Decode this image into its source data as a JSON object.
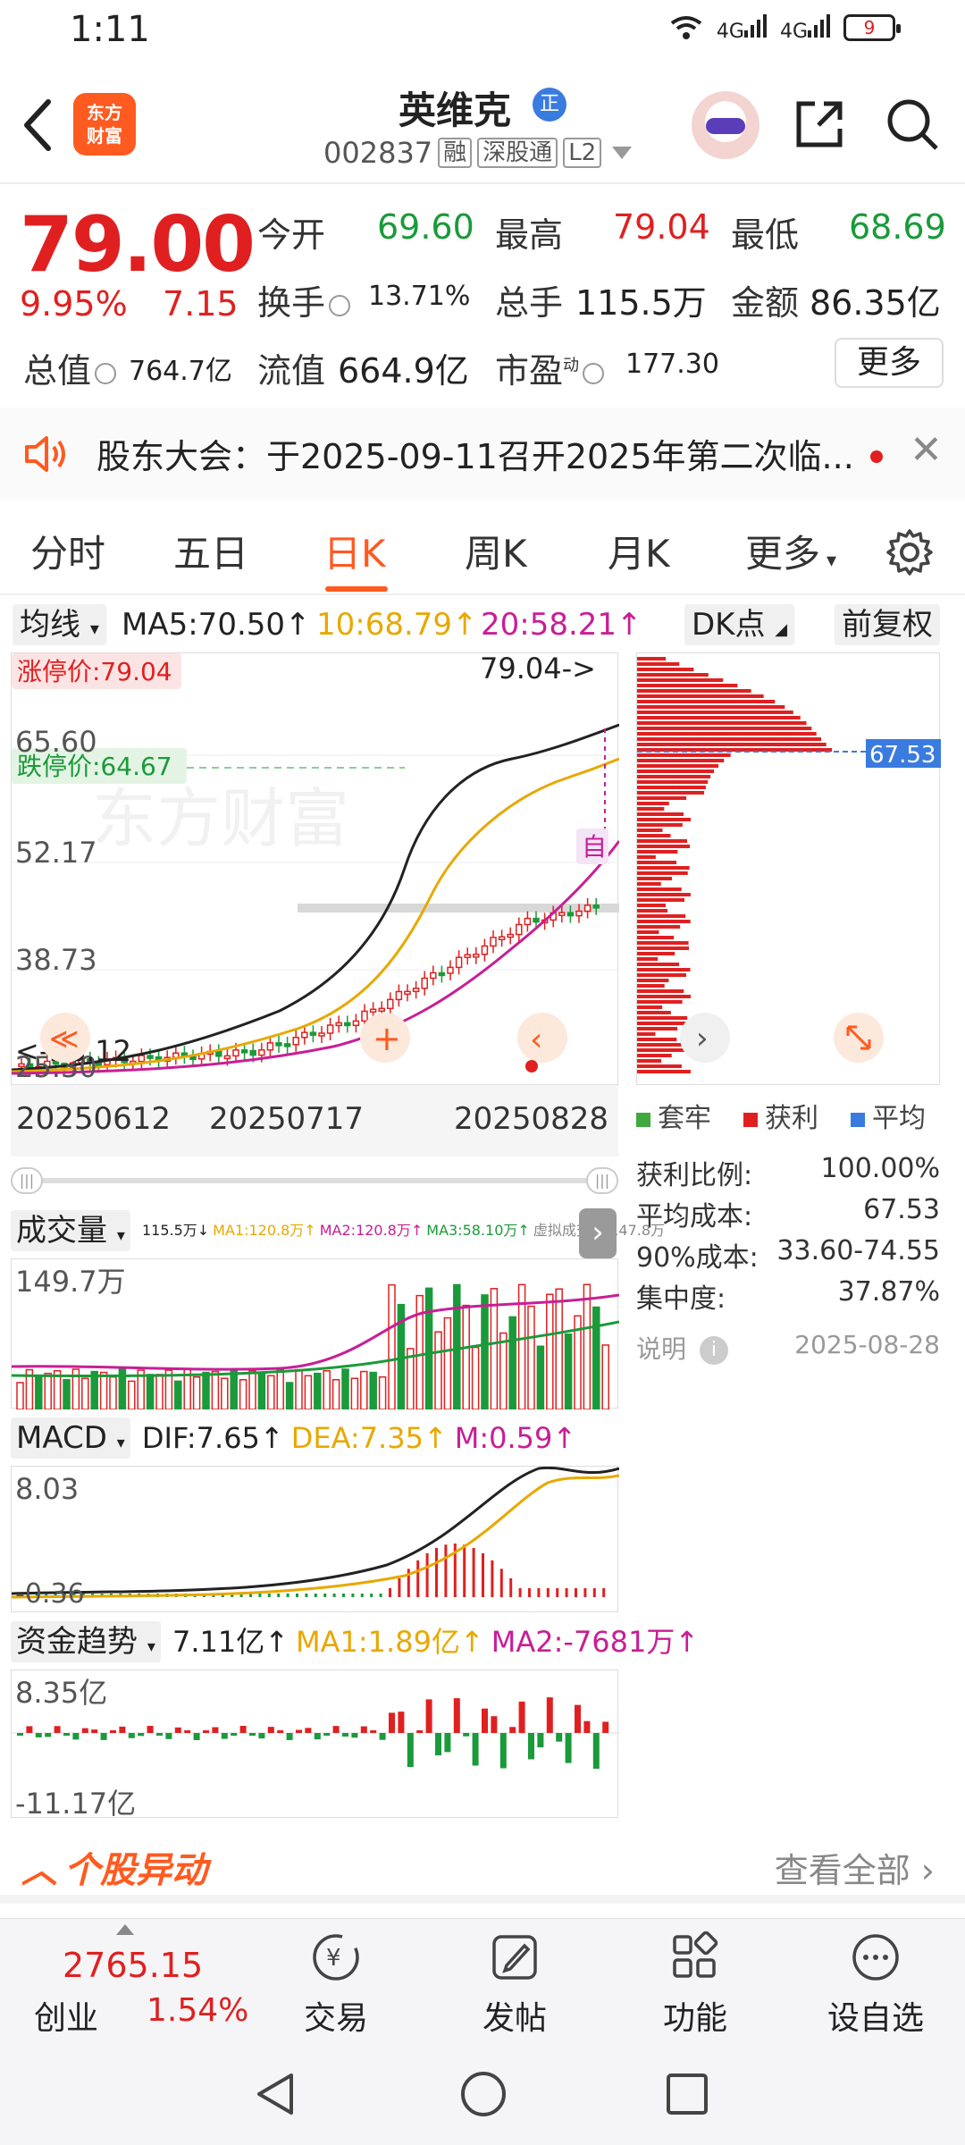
{
  "status_bar": {
    "time": "1:11",
    "network": "4G",
    "network2": "4G",
    "battery": "9"
  },
  "header": {
    "logo_text_1": "东方",
    "logo_text_2": "财富",
    "stock_name": "英维克",
    "name_badge": "正",
    "stock_code": "002837",
    "tags": [
      "融",
      "深股通",
      "L2"
    ]
  },
  "quote": {
    "price": "79.00",
    "change_pct": "9.95%",
    "change_amt": "7.15",
    "open_label": "今开",
    "open": "69.60",
    "high_label": "最高",
    "high": "79.04",
    "low_label": "最低",
    "low": "68.69",
    "turnover_label": "换手",
    "turnover": "13.71%",
    "volume_label": "总手",
    "volume": "115.5万",
    "amount_label": "金额",
    "amount": "86.35亿",
    "mktcap_label": "总值",
    "mktcap": "764.7亿",
    "float_label": "流值",
    "float_cap": "664.9亿",
    "pe_label": "市盈",
    "pe_sup": "动",
    "pe": "177.30",
    "more_button": "更多"
  },
  "notice": {
    "text": "股东大会：于2025-09-11召开2025年第二次临..."
  },
  "tabs": [
    "分时",
    "五日",
    "日K",
    "周K",
    "月K",
    "更多"
  ],
  "active_tab": "日K",
  "chart_controls": {
    "ma_select": "均线",
    "ma5": "MA5:70.50↑",
    "ma10": "10:68.79↑",
    "ma20": "20:58.21↑",
    "dk_select": "DK点",
    "adjust": "前复权"
  },
  "kline": {
    "limit_up_label": "涨停价:79.04",
    "limit_down_label": "跌停价:64.67",
    "y_ticks": [
      "65.60",
      "52.17",
      "38.73",
      "25.30"
    ],
    "high_marker": "79.04->",
    "low_marker": "<-26.12",
    "auto_label": "自",
    "watermark": "东方财富",
    "dates": [
      "20250612",
      "20250717",
      "20250828"
    ]
  },
  "profile": {
    "avg_cost_marker": "67.53",
    "legend": [
      "套牢",
      "获利",
      "平均"
    ],
    "stats": [
      {
        "label": "获利比例:",
        "value": "100.00%"
      },
      {
        "label": "平均成本:",
        "value": "67.53"
      },
      {
        "label": "90%成本:",
        "value": "33.60-74.55"
      },
      {
        "label": "集中度:",
        "value": "37.87%"
      }
    ],
    "note_label": "说明",
    "note_date": "2025-08-28"
  },
  "volume": {
    "select": "成交量",
    "values_line": "115.5万↓",
    "ma1": "MA1:120.8万↑",
    "ma2": "MA2:120.8万↑",
    "ma3": "MA3:58.10万↑",
    "virtual": "虚拟成交量:147.8万",
    "max_label": "149.7万"
  },
  "macd": {
    "select": "MACD",
    "dif": "DIF:7.65↑",
    "dea": "DEA:7.35↑",
    "m": "M:0.59↑",
    "top_label": "8.03",
    "bottom_label": "-0.36"
  },
  "fund": {
    "select": "资金趋势",
    "value": "7.11亿↑",
    "ma1": "MA1:1.89亿↑",
    "ma2": "MA2:-7681万↑",
    "top_label": "8.35亿",
    "bottom_label": "-11.17亿"
  },
  "alert": {
    "title": "个股异动",
    "more": "查看全部"
  },
  "bottom_nav": {
    "index_value": "2765.15",
    "index_name": "创业",
    "index_pct": "1.54%",
    "items": [
      "交易",
      "发帖",
      "功能",
      "设自选"
    ]
  },
  "colors": {
    "up": "#e02020",
    "down": "#1a9a3a",
    "accent": "#ff5a1f"
  }
}
